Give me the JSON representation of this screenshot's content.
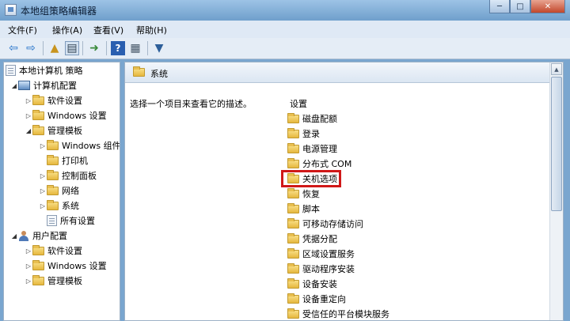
{
  "window": {
    "title": "本地组策略编辑器",
    "minimize": "─",
    "maximize": "□",
    "close": "✕"
  },
  "menu": [
    "文件(F)",
    "操作(A)",
    "查看(V)",
    "帮助(H)"
  ],
  "toolbar_icons": [
    "back-arrow-icon",
    "forward-arrow-icon",
    "up-folder-icon",
    "show-tree-icon",
    "export-list-icon",
    "help-icon",
    "properties-icon",
    "filter-icon"
  ],
  "tree": {
    "root": "本地计算机 策略",
    "computer_config": "计算机配置",
    "software_settings": "软件设置",
    "windows_settings": "Windows 设置",
    "admin_templates": "管理模板",
    "windows_components": "Windows 组件",
    "printers": "打印机",
    "control_panel": "控制面板",
    "network": "网络",
    "system": "系统",
    "all_settings": "所有设置",
    "user_config": "用户配置",
    "user_software_settings": "软件设置",
    "user_windows_settings": "Windows 设置",
    "user_admin_templates": "管理模板"
  },
  "detail": {
    "header_title": "系统",
    "description": "选择一个项目来查看它的描述。",
    "column_header": "设置",
    "items": [
      "磁盘配额",
      "登录",
      "电源管理",
      "分布式 COM",
      "关机选项",
      "恢复",
      "脚本",
      "可移动存储访问",
      "凭据分配",
      "区域设置服务",
      "驱动程序安装",
      "设备安装",
      "设备重定向",
      "受信任的平台模块服务"
    ],
    "highlighted_item": "关机选项"
  },
  "colors": {
    "highlight_border": "#d01818",
    "folder": "#e6b83e"
  }
}
